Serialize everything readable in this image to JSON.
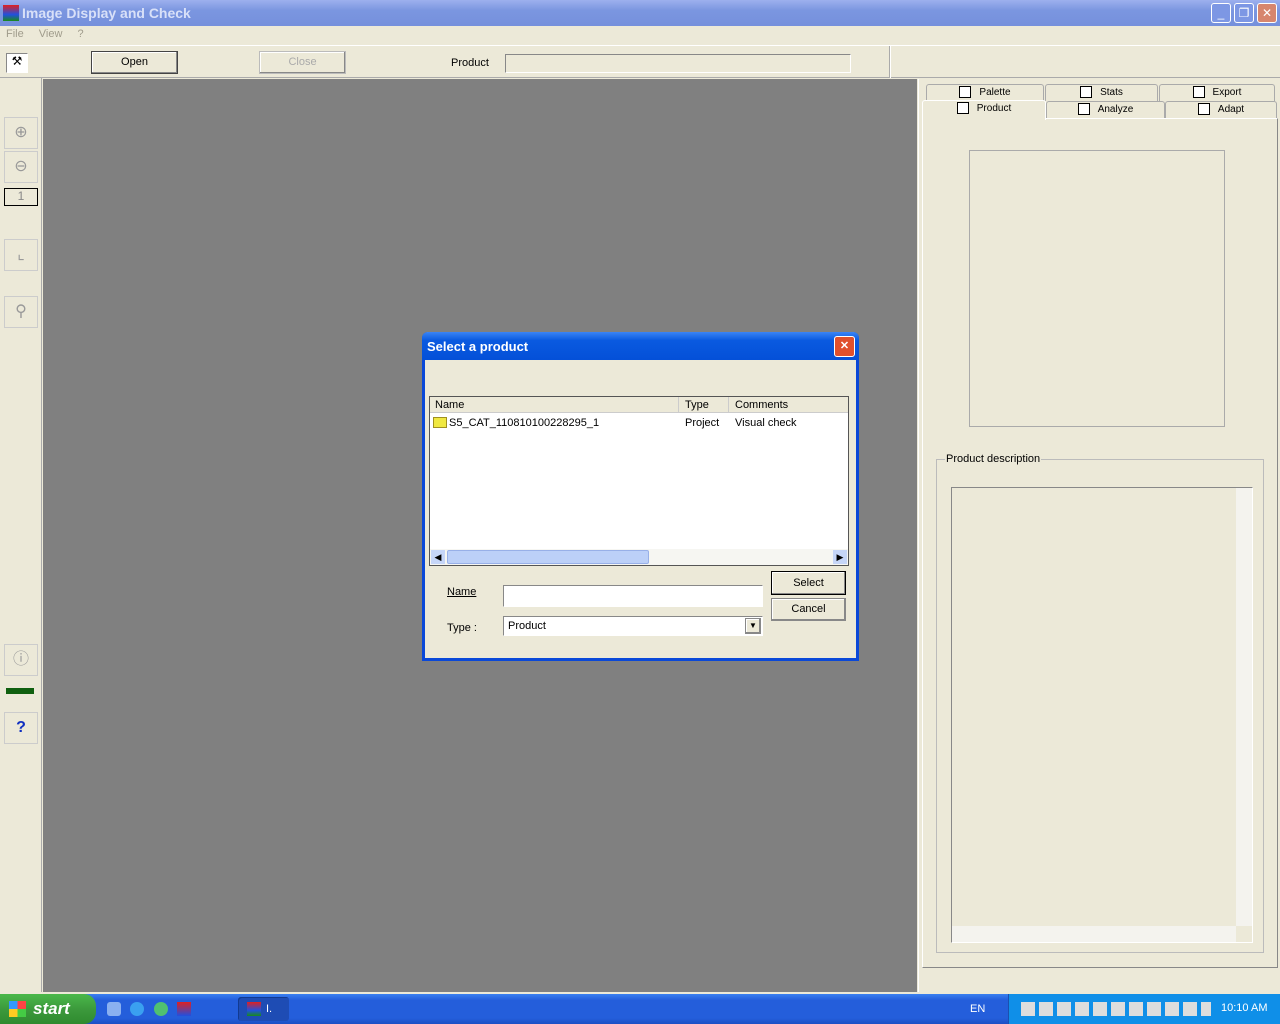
{
  "window": {
    "title": "Image Display and Check"
  },
  "menu": [
    "File",
    "View",
    "?"
  ],
  "toolbar": {
    "open_label": "Open",
    "close_label": "Close",
    "product_label": "Product",
    "product_value": ""
  },
  "left_toolbar": {
    "zoom_value": "1"
  },
  "tabs": {
    "row1": [
      "Palette",
      "Stats",
      "Export"
    ],
    "row2": [
      "Product",
      "Analyze",
      "Adapt"
    ],
    "active": "Product"
  },
  "right_panel": {
    "description_label": "Product description"
  },
  "dialog": {
    "title": "Select a product",
    "columns": [
      "Name",
      "Type",
      "Comments"
    ],
    "rows": [
      {
        "name": "S5_CAT_110810100228295_1",
        "type": "Project",
        "comments": "Visual check"
      }
    ],
    "name_label": "Name",
    "name_value": "",
    "type_label": "Type :",
    "type_value": "Product",
    "select_label": "Select",
    "cancel_label": "Cancel"
  },
  "taskbar": {
    "start_label": "start",
    "task_label": "I.",
    "language": "EN",
    "clock": "10:10 AM"
  },
  "colors": {
    "workspace": "#808080",
    "dialog_border": "#0a48d8",
    "taskbar": "#245edb",
    "start": "#3c9a3c"
  }
}
